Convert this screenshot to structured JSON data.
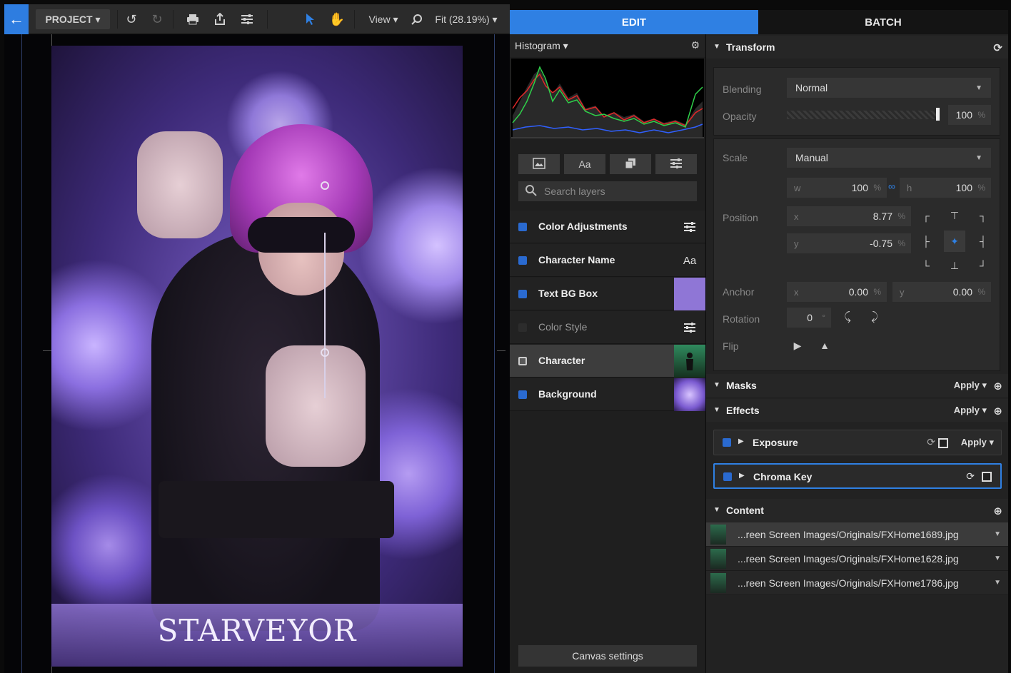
{
  "toolbar": {
    "back_icon": "arrow-left-icon",
    "project_label": "PROJECT ▾",
    "view_label": "View ▾",
    "zoom_label": "Fit (28.19%) ▾"
  },
  "tabs": {
    "edit": "EDIT",
    "batch": "BATCH"
  },
  "canvas": {
    "artwork_title": "STARVEYOR"
  },
  "layers_panel": {
    "histogram_label": "Histogram ▾",
    "tool_text_label": "Aa",
    "search_placeholder": "Search layers",
    "layers": [
      {
        "name": "Color Adjustments",
        "thumb": "≡"
      },
      {
        "name": "Character Name",
        "thumb": "Aa"
      },
      {
        "name": "Text BG Box",
        "thumb": ""
      },
      {
        "name": "Color Style",
        "thumb": "≡"
      },
      {
        "name": "Character",
        "thumb": ""
      },
      {
        "name": "Background",
        "thumb": ""
      }
    ],
    "canvas_settings_label": "Canvas settings"
  },
  "properties": {
    "transform": {
      "title": "Transform",
      "blending_label": "Blending",
      "blending_value": "Normal",
      "opacity_label": "Opacity",
      "opacity_value": "100",
      "opacity_fraction": 1.0,
      "scale_label": "Scale",
      "scale_value": "Manual",
      "scale_w_label": "w",
      "scale_w": "100",
      "scale_h_label": "h",
      "scale_h": "100",
      "position_label": "Position",
      "position_x_label": "x",
      "position_x": "8.77",
      "position_y_label": "y",
      "position_y": "-0.75",
      "anchor_label": "Anchor",
      "anchor_x_label": "x",
      "anchor_x": "0.00",
      "anchor_y_label": "y",
      "anchor_y": "0.00",
      "rotation_label": "Rotation",
      "rotation_value": "0",
      "rotation_unit": "°",
      "flip_label": "Flip",
      "percent_unit": "%"
    },
    "masks": {
      "title": "Masks",
      "apply_label": "Apply ▾"
    },
    "effects": {
      "title": "Effects",
      "apply_label": "Apply ▾",
      "items": [
        {
          "name": "Exposure",
          "apply_label": "Apply ▾"
        },
        {
          "name": "Chroma Key"
        }
      ]
    },
    "content": {
      "title": "Content",
      "items": [
        "...reen Screen Images/Originals/FXHome1689.jpg",
        "...reen Screen Images/Originals/FXHome1628.jpg",
        "...reen Screen Images/Originals/FXHome1786.jpg"
      ]
    }
  },
  "colors": {
    "accent": "#2f80e3",
    "panel_bg": "#222222",
    "text_bg_box_swatch": "#8f76d6"
  }
}
